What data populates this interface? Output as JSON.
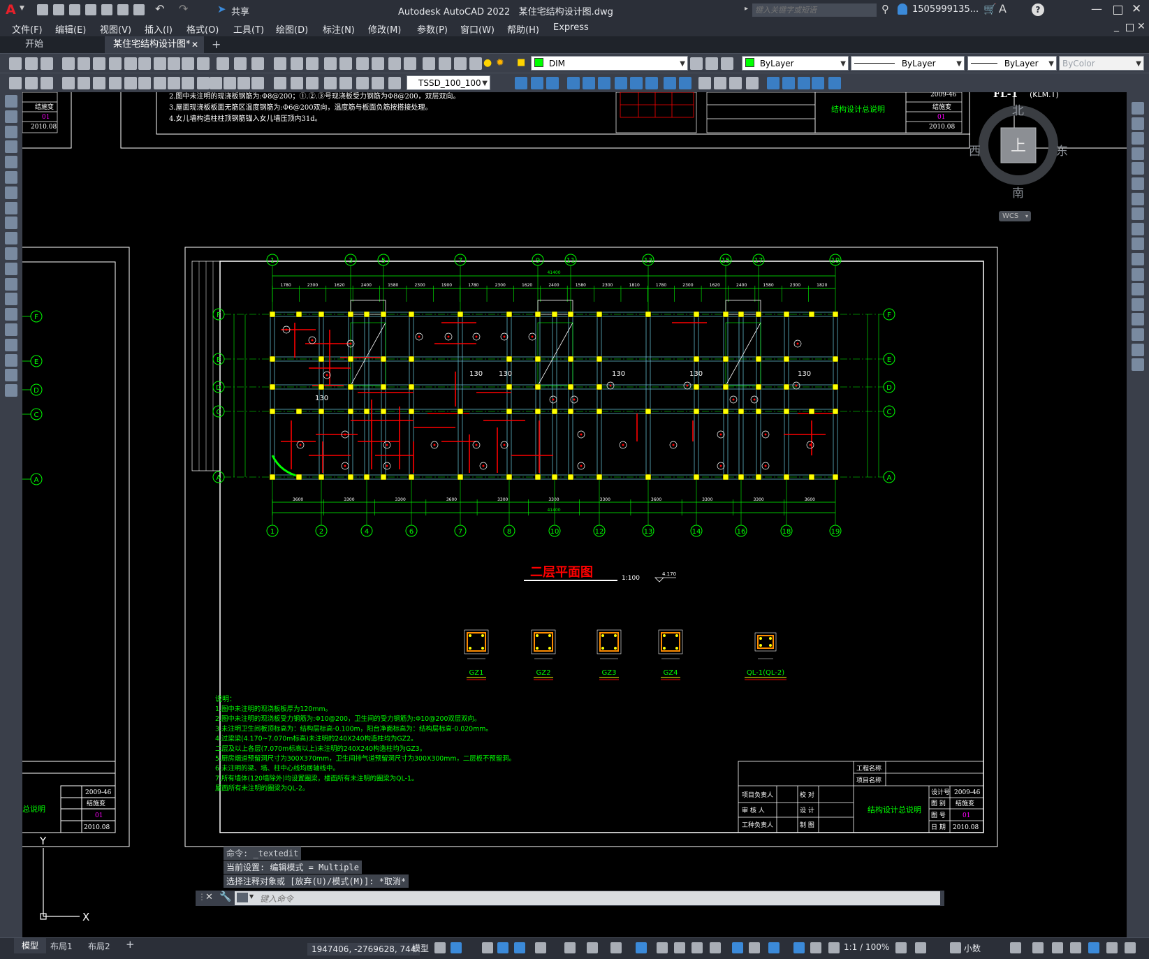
{
  "app": {
    "title": "Autodesk AutoCAD 2022",
    "file": "某住宅结构设计图.dwg",
    "share_label": "共享",
    "search_placeholder": "键入关键字或短语",
    "user": "1505999135...",
    "help_label": "?"
  },
  "menu": [
    "文件(F)",
    "编辑(E)",
    "视图(V)",
    "插入(I)",
    "格式(O)",
    "工具(T)",
    "绘图(D)",
    "标注(N)",
    "修改(M)",
    "参数(P)",
    "窗口(W)",
    "帮助(H)",
    "Express"
  ],
  "tabs": {
    "start": "开始",
    "doc": "某住宅结构设计图*",
    "add": "+"
  },
  "toolbar": {
    "layer_name": "DIM",
    "color": "ByLayer",
    "linetype": "ByLayer",
    "lineweight": "ByLayer",
    "plotstyle": "ByColor",
    "dimstyle": "TSSD_100_100"
  },
  "viewcube": {
    "label": "FL-1",
    "sublabel": "(KLM.T)",
    "top": "上",
    "north": "北",
    "south": "南",
    "east": "东",
    "west": "西",
    "wcs": "WCS"
  },
  "drawing": {
    "plan_title": "二层平面图",
    "scale": "1:100",
    "level": "4.170",
    "total_width": "41400",
    "grid_top": [
      "1",
      "3",
      "5",
      "7",
      "9",
      "11",
      "13",
      "15",
      "17",
      "19"
    ],
    "grid_bottom": [
      "1",
      "2",
      "4",
      "6",
      "7",
      "8",
      "10",
      "12",
      "13",
      "14",
      "16",
      "18",
      "19"
    ],
    "grid_rows": [
      "F",
      "E",
      "D",
      "C",
      "A"
    ],
    "top_dims": [
      "1780",
      "2300",
      "1620",
      "2400",
      "1580",
      "2300",
      "1900",
      "1780",
      "2300",
      "1620",
      "2400",
      "1580",
      "2300",
      "1810",
      "1780",
      "2300",
      "1620",
      "2400",
      "1580",
      "2300",
      "1820"
    ],
    "bottom_dims": [
      "3600",
      "3300",
      "3300",
      "3600",
      "3300",
      "3300",
      "3300",
      "3600",
      "3300",
      "3300",
      "3600"
    ],
    "slab_labels": [
      "130",
      "130",
      "130",
      "130",
      "130",
      "130"
    ],
    "details": [
      "GZ1",
      "GZ2",
      "GZ3",
      "GZ4",
      "QL-1(QL-2)"
    ],
    "notes_title": "说明：",
    "notes": [
      "1.图中未注明的现浇板板厚为120mm。",
      "2.图中未注明的现浇板受力钢筋为:Φ10@200，卫生间的受力钢筋为:Φ10@200双层双向。",
      "3.未注明卫生间板顶标高为：结构层标高-0.100m，阳台净面标高为：结构层标高-0.020mm。",
      "4.过梁梁(4.170~7.070m标高)未注明的240X240构造柱均为GZ2。",
      "  二层及以上各层(7.070m标高以上)未注明的240X240构造柱均为GZ3。",
      "5.厨房烟道预留洞尺寸为300X370mm，卫生间排气道预留洞尺寸为300X300mm，二层板不预留洞。",
      "6.未注明的梁、墙、柱中心线均居轴线中。",
      "7.所有墙体(120墙除外)均设置圈梁，楼面所有未注明的圈梁为QL-1。",
      "  屋面所有未注明的圈梁为QL-2。"
    ],
    "top_notes": [
      "2.图中未注明的现浇板钢筋为:Φ8@200；①.②.③号现浇板受力钢筋为Φ8@200，双层双向。",
      "3.屋面现浇板板面无筋区温度钢筋为:Φ6@200双向，温度筋与板面负筋按搭接处理。",
      "4.女儿墙构造柱柱顶钢筋锚入女儿墙压顶内31d。"
    ],
    "title_block": {
      "project_label": "工程名称",
      "item_label": "项目名称",
      "rows": [
        "项目负责人",
        "审 核 人",
        "工种负责人"
      ],
      "mid": [
        "校 对",
        "设 计",
        "制 图"
      ],
      "sheet_title": "结构设计总说明",
      "design_no_label": "设计号",
      "design_no": "2009-46",
      "category_label": "图 别",
      "category": "结施变",
      "sheet_no_label": "图 号",
      "sheet_no": "01",
      "date_label": "日 期",
      "date": "2010.08"
    },
    "left_block_title": "总说明"
  },
  "ucs": {
    "x": "X",
    "y": "Y"
  },
  "commands": [
    "命令: _textedit",
    "当前设置: 编辑模式 = Multiple",
    "选择注释对象或 [放弃(U)/模式(M)]: *取消*"
  ],
  "command_placeholder": "键入命令",
  "layout_tabs": [
    "模型",
    "布局1",
    "布局2",
    "+"
  ],
  "status": {
    "coords": "1947406, -2769628, 744",
    "space": "模型",
    "scale": "1:1 / 100%",
    "units": "小数"
  },
  "colors": {
    "grid_green": "#00ff00",
    "wall_cyan": "#5fb7c8",
    "column_yellow": "#ffff00",
    "rebar_red": "#ff0000",
    "text_white": "#ffffff",
    "ui_dark": "#2b2f38"
  }
}
